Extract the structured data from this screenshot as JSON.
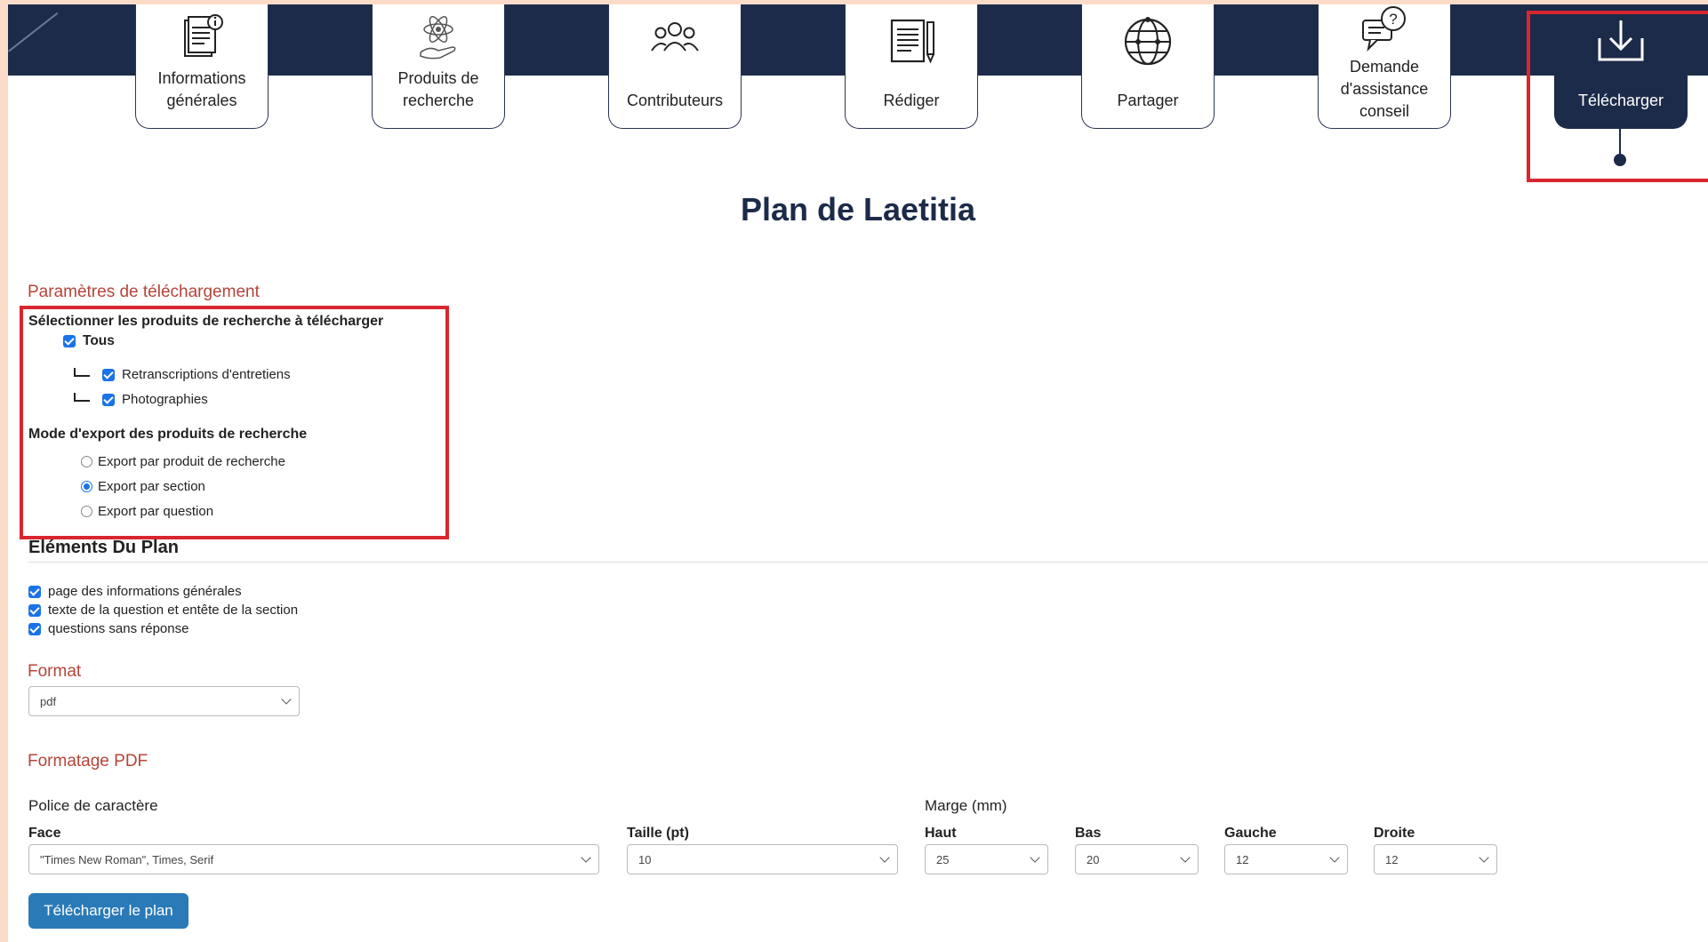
{
  "nav": {
    "items": [
      {
        "label": "Informations\ngénérales",
        "icon": "document-info-icon"
      },
      {
        "label": "Produits de\nrecherche",
        "icon": "science-hand-icon"
      },
      {
        "label": "Contributeurs",
        "icon": "people-group-icon"
      },
      {
        "label": "Rédiger",
        "icon": "write-document-icon"
      },
      {
        "label": "Partager",
        "icon": "globe-network-icon"
      },
      {
        "label": "Demande\nd'assistance\nconseil",
        "icon": "question-chat-icon"
      },
      {
        "label": "Télécharger",
        "icon": "download-icon",
        "active": true
      }
    ]
  },
  "page_title": "Plan de Laetitia",
  "download_params": {
    "heading": "Paramètres de téléchargement",
    "select_products_label": "Sélectionner les produits de recherche à télécharger",
    "all_label": "Tous",
    "products": [
      "Retranscriptions d'entretiens",
      "Photographies"
    ],
    "export_mode_label": "Mode d'export des produits de recherche",
    "export_modes": [
      "Export par produit de recherche",
      "Export par section",
      "Export par question"
    ],
    "selected_export_mode": "Export par section"
  },
  "plan_elements": {
    "heading": "Eléments Du Plan",
    "options": [
      "page des informations générales",
      "texte de la question et entête de la section",
      "questions sans réponse"
    ]
  },
  "format": {
    "heading": "Format",
    "value": "pdf"
  },
  "pdf_formatting": {
    "heading": "Formatage PDF",
    "font_label": "Police de caractère",
    "face_label": "Face",
    "face_value": "\"Times New Roman\", Times, Serif",
    "size_label": "Taille (pt)",
    "size_value": "10",
    "margin_label": "Marge (mm)",
    "top_label": "Haut",
    "top_value": "25",
    "bottom_label": "Bas",
    "bottom_value": "20",
    "left_label": "Gauche",
    "left_value": "12",
    "right_label": "Droite",
    "right_value": "12"
  },
  "download_button": "Télécharger le plan",
  "colors": {
    "navy": "#1c2b4a",
    "section_heading": "#b5443a",
    "highlight": "#d8262f",
    "button": "#2a7ab8",
    "checkbox": "#1a73e8"
  }
}
